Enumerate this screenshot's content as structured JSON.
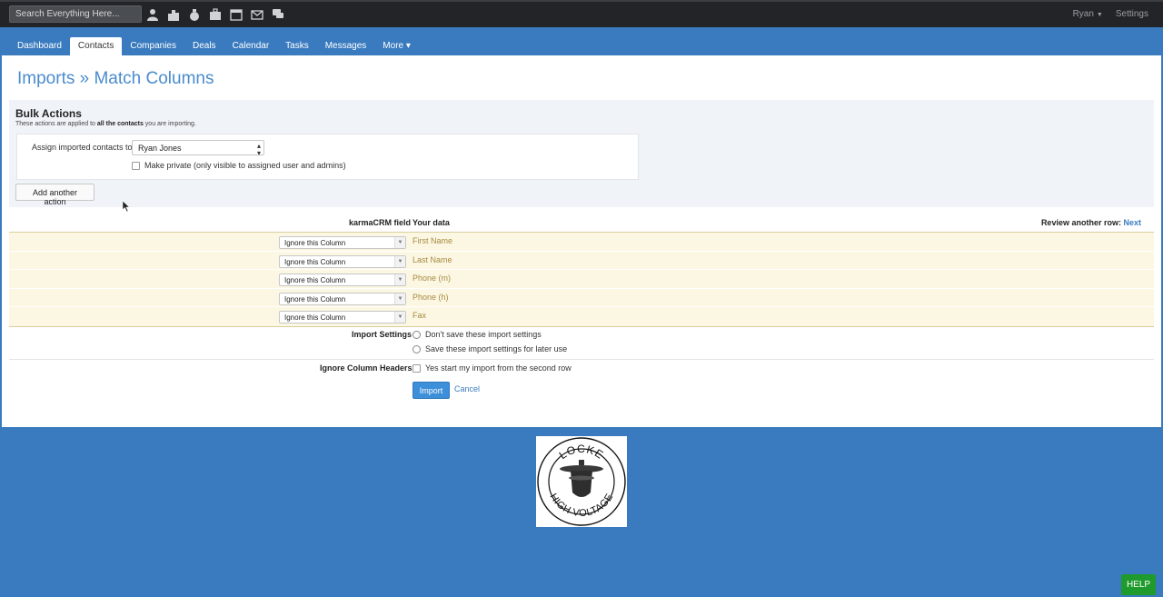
{
  "topbar": {
    "search_placeholder": "Search Everything Here...",
    "icons": [
      "contacts-icon",
      "companies-icon",
      "deals-icon",
      "cases-icon",
      "calendar-icon",
      "messages-icon",
      "chat-icon"
    ],
    "user": "Ryan",
    "settings": "Settings"
  },
  "nav": {
    "tabs": [
      {
        "label": "Dashboard"
      },
      {
        "label": "Contacts"
      },
      {
        "label": "Companies"
      },
      {
        "label": "Deals"
      },
      {
        "label": "Calendar"
      },
      {
        "label": "Tasks"
      },
      {
        "label": "Messages"
      },
      {
        "label": "More ▾"
      }
    ],
    "active": "Contacts"
  },
  "page": {
    "title": "Imports » Match Columns"
  },
  "bulk": {
    "heading": "Bulk Actions",
    "desc_pre": "These actions are applied to ",
    "desc_bold": "all the contacts",
    "desc_post": " you are importing.",
    "assign_label": "Assign imported contacts to",
    "assign_value": "Ryan Jones",
    "private_label": "Make private (only visible to assigned user and admins)",
    "add_button": "Add another action"
  },
  "mapping": {
    "header_field": "karmaCRM field",
    "header_data": "Your data",
    "review_label": "Review another row:",
    "review_link": "Next",
    "rows": [
      {
        "select": "Ignore this Column",
        "data": "First Name"
      },
      {
        "select": "Ignore this Column",
        "data": "Last Name"
      },
      {
        "select": "Ignore this Column",
        "data": "Phone (m)"
      },
      {
        "select": "Ignore this Column",
        "data": "Phone (h)"
      },
      {
        "select": "Ignore this Column",
        "data": "Fax"
      }
    ]
  },
  "settings": {
    "label": "Import Settings",
    "option1": "Don't save these import settings",
    "option2": "Save these import settings for later use",
    "ignore_label": "Ignore Column Headers?",
    "ignore_option": "Yes start my import from the second row"
  },
  "actions": {
    "import": "Import",
    "cancel": "Cancel"
  },
  "logo": {
    "top_text": "LOCKE",
    "bottom_text": "HIGH VOLTAGE"
  },
  "help": "HELP"
}
